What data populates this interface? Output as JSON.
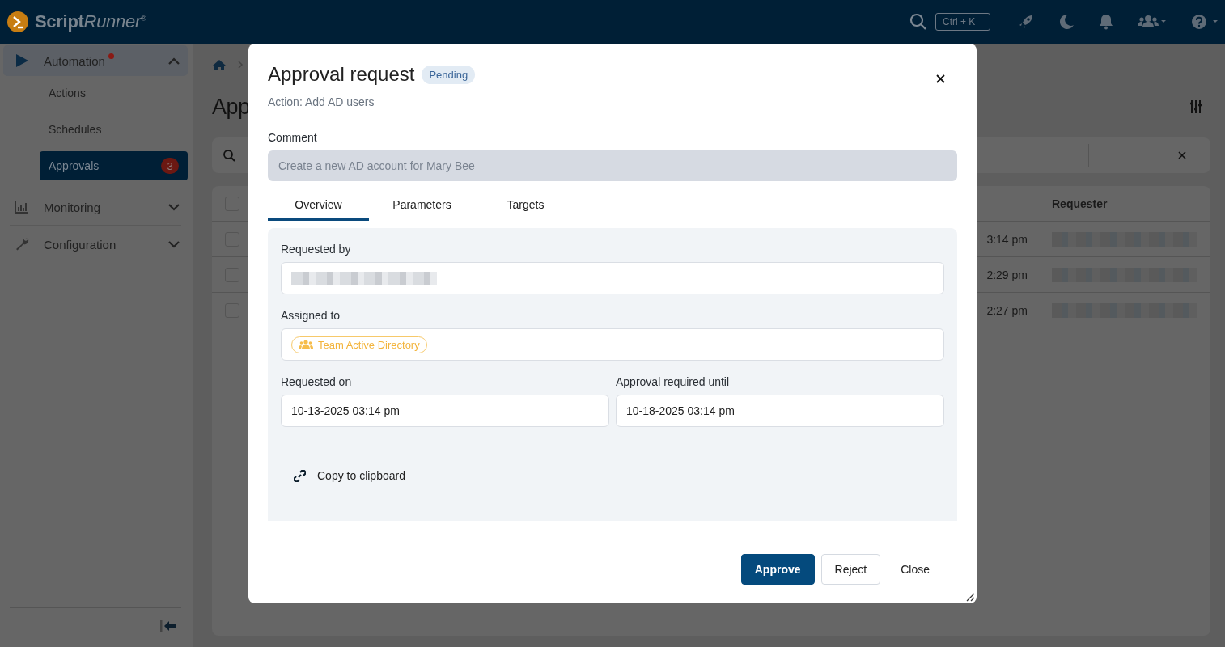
{
  "header": {
    "logo_name": "Script",
    "logo_tail": "Runner$^{®}$",
    "search_shortcut": "Ctrl + K"
  },
  "sidebar": {
    "items": [
      {
        "label": "Automation",
        "expanded": true,
        "notification": true,
        "children": [
          {
            "label": "Actions",
            "selected": false
          },
          {
            "label": "Schedules",
            "selected": false
          },
          {
            "label": "Approvals",
            "selected": true,
            "badge": "3"
          }
        ]
      },
      {
        "label": "Monitoring",
        "expanded": false
      },
      {
        "label": "Configuration",
        "expanded": false
      }
    ]
  },
  "main": {
    "title": "App",
    "table": {
      "header_checked": false,
      "requester_header": "Requester",
      "rows": [
        {
          "checked": false,
          "time": "3:14 pm"
        },
        {
          "checked": false,
          "time": "2:29 pm"
        },
        {
          "checked": false,
          "time": "2:27 pm"
        }
      ]
    }
  },
  "modal": {
    "title": "Approval request",
    "status": "Pending",
    "subtitle": "Action: Add AD users",
    "comment_label": "Comment",
    "comment_value": "Create a new AD account for Mary Bee",
    "tabs": [
      {
        "label": "Overview",
        "selected": true
      },
      {
        "label": "Parameters",
        "selected": false
      },
      {
        "label": "Targets",
        "selected": false
      }
    ],
    "requested_by_label": "Requested by",
    "assigned_to_label": "Assigned to",
    "assigned_to": "Team Active Directory",
    "requested_on_label": "Requested on",
    "requested_on": "10-13-2025 03:14 pm",
    "required_until_label": "Approval required until",
    "required_until": "10-18-2025 03:14 pm",
    "copy_link": "Copy to clipboard",
    "buttons": [
      {
        "label": "Approve",
        "kind": "primary"
      },
      {
        "label": "Reject",
        "kind": "secondary"
      },
      {
        "label": "Close",
        "kind": "plain"
      }
    ]
  }
}
